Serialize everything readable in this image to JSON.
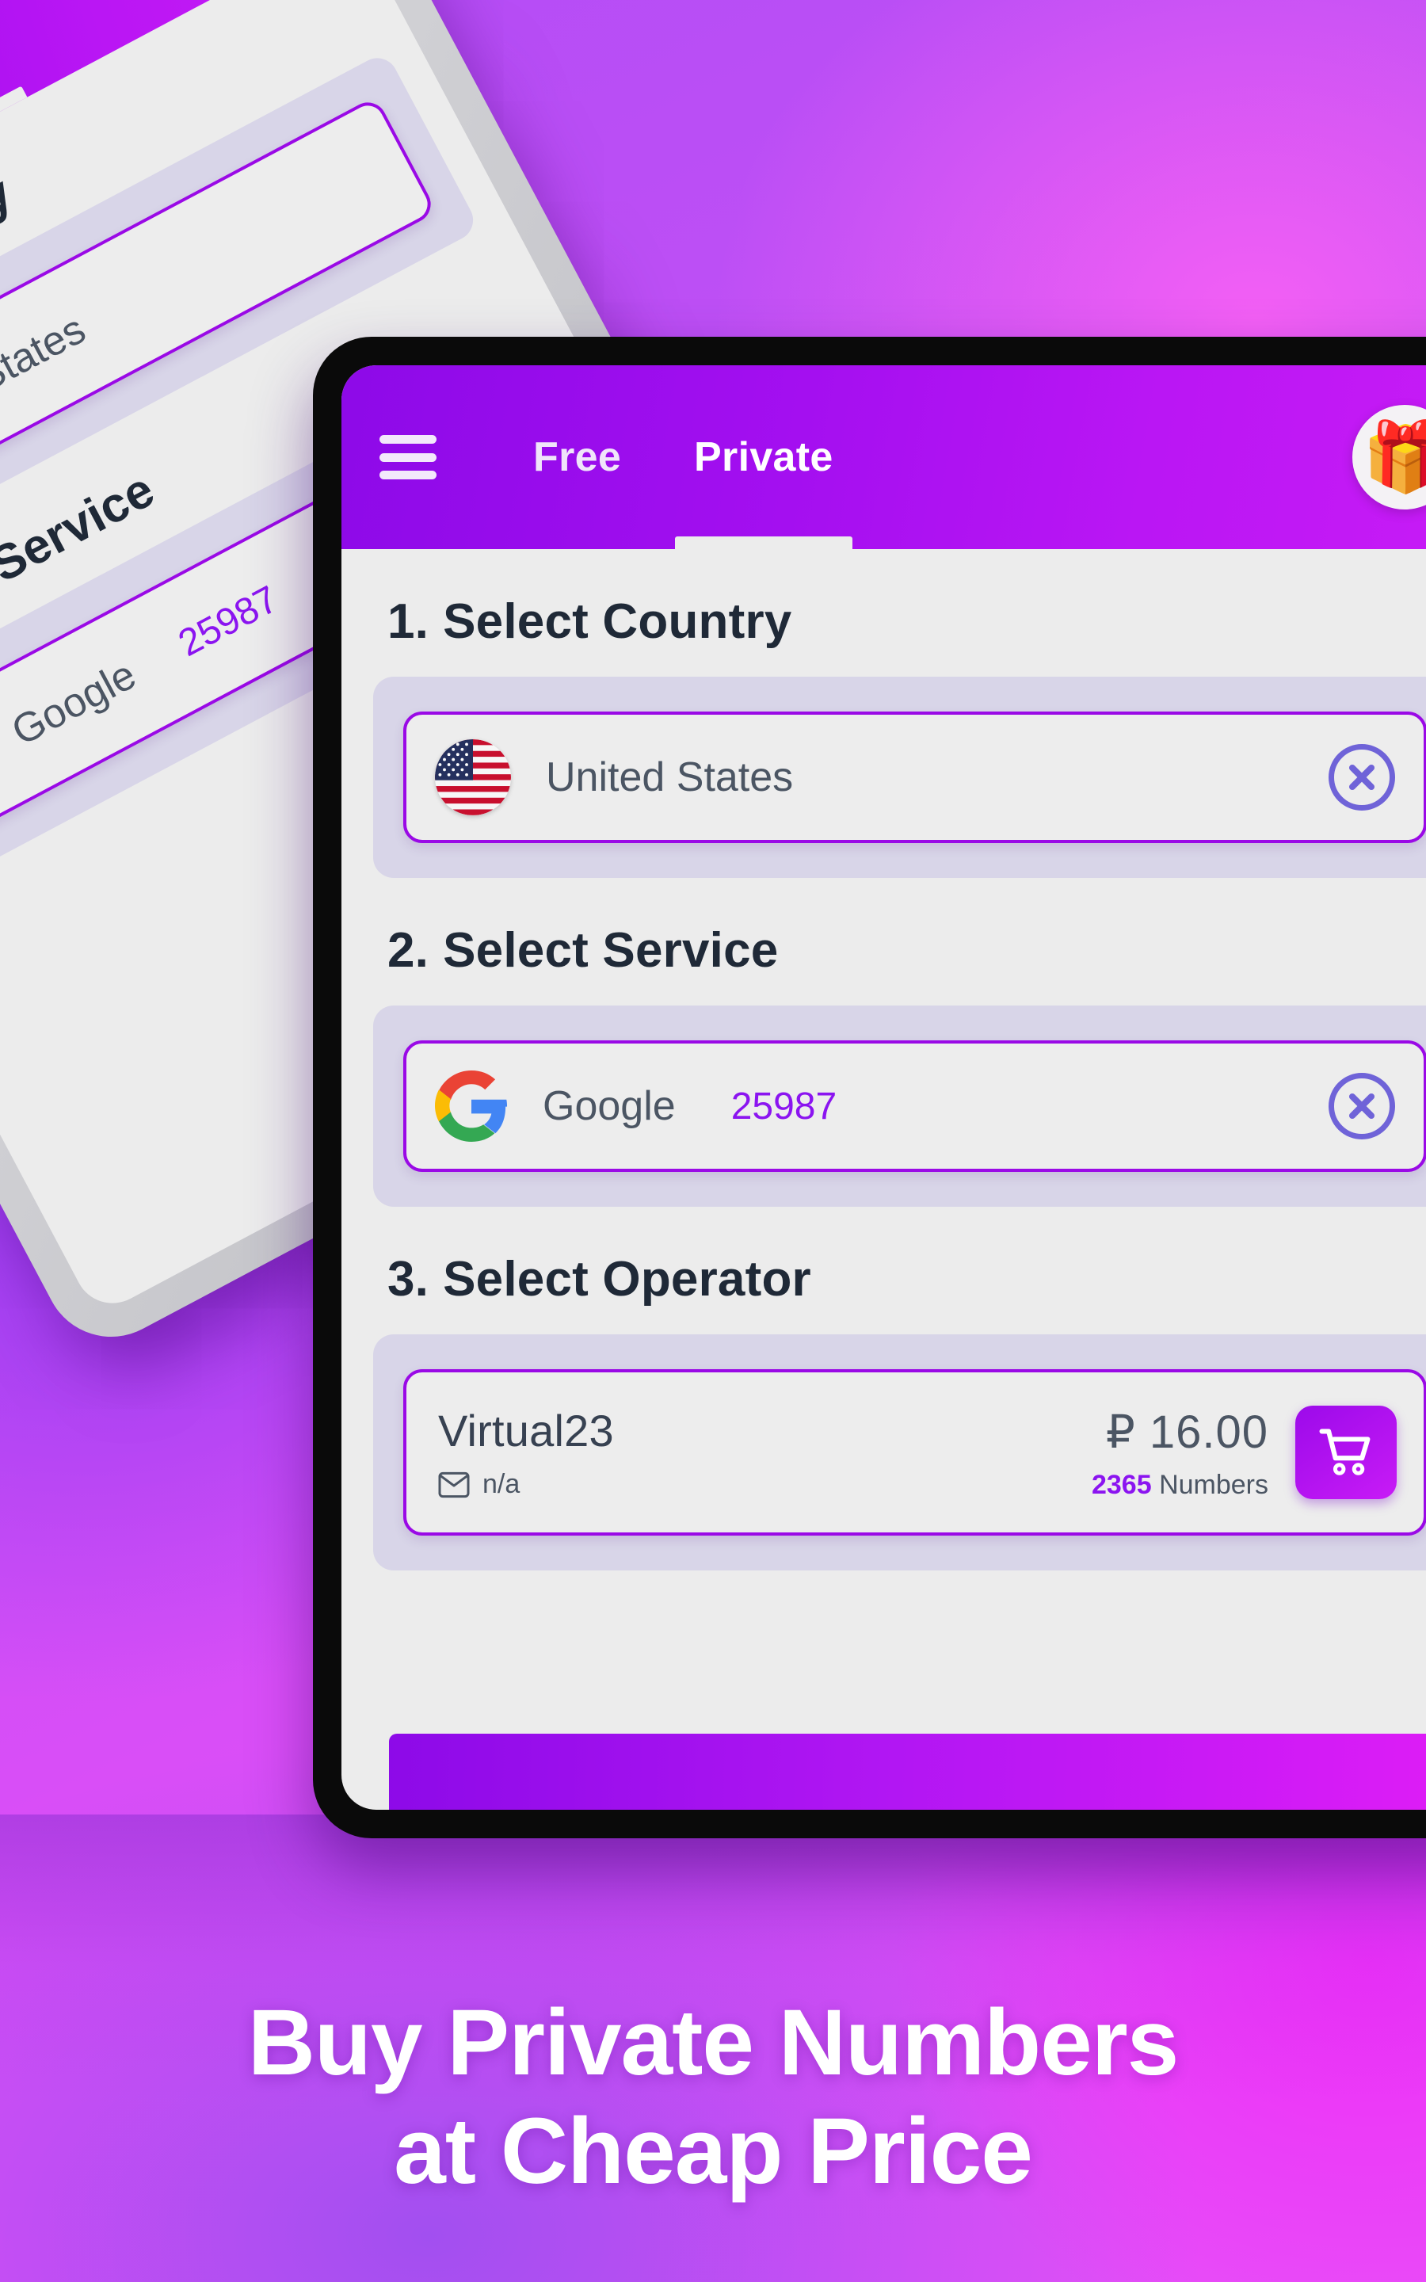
{
  "appbar": {
    "menu_icon": "hamburger-menu-icon",
    "gift_icon": "gift-box-icon",
    "gift_glyph": "🎁",
    "tabs": [
      {
        "label": "Free",
        "active": false
      },
      {
        "label": "Private",
        "active": true
      }
    ]
  },
  "sections": {
    "country": {
      "number": "1.",
      "title": "Select Country",
      "value": "United States",
      "flag_icon": "us-flag-icon",
      "clear_icon": "clear-circle-x-icon"
    },
    "service": {
      "number": "2.",
      "title": "Select Service",
      "name": "Google",
      "logo_icon": "google-logo-icon",
      "count": "25987",
      "clear_icon": "clear-circle-x-icon"
    },
    "operator": {
      "number": "3.",
      "title": "Select Operator",
      "name": "Virtual23",
      "sub_icon": "envelope-icon",
      "sub_label": "n/a",
      "price": "₽ 16.00",
      "stock_count": "2365",
      "stock_label": "Numbers",
      "cart_icon": "shopping-cart-icon"
    }
  },
  "headline": {
    "line1": "Buy Private Numbers",
    "line2": "at Cheap Price"
  },
  "colors": {
    "brand_purple": "#9a09e6",
    "brand_magenta": "#e11df7",
    "accent_violet": "#8b14f0",
    "clear_icon": "#6f63d8",
    "screen_bg": "#ececec",
    "panel_bg": "#d8d5e8"
  }
}
